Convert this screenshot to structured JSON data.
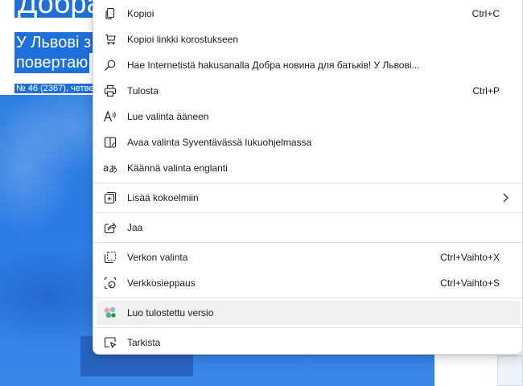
{
  "article": {
    "title_top": "Добра",
    "headline_line1": "У Львові з",
    "headline_line2": "повертаю",
    "meta": "№ 46 (2367), четве"
  },
  "menu": {
    "items": [
      {
        "label": "Kopioi",
        "shortcut": "Ctrl+C",
        "icon": "copy-icon"
      },
      {
        "label": "Kopioi linkki korostukseen",
        "shortcut": "",
        "icon": "link-highlight-icon"
      },
      {
        "label": "Hae Internetistä hakusanalla Добра новина для батьків! У Львові...",
        "shortcut": "",
        "icon": "search-icon"
      },
      {
        "label": "Tulosta",
        "shortcut": "Ctrl+P",
        "icon": "print-icon"
      },
      {
        "label": "Lue valinta ääneen",
        "shortcut": "",
        "icon": "read-aloud-icon"
      },
      {
        "label": "Avaa valinta Syventävässä lukuohjelmassa",
        "shortcut": "",
        "icon": "immersive-reader-icon"
      },
      {
        "label": "Käännä valinta englanti",
        "shortcut": "",
        "icon": "translate-icon"
      },
      {
        "label": "Lisää kokoelmiin",
        "shortcut": "",
        "icon": "collections-icon"
      },
      {
        "label": "Jaa",
        "shortcut": "",
        "icon": "share-icon"
      },
      {
        "label": "Verkon valinta",
        "shortcut": "Ctrl+Vaihto+X",
        "icon": "web-select-icon"
      },
      {
        "label": "Verkkosieppaus",
        "shortcut": "Ctrl+Vaihto+S",
        "icon": "web-capture-icon"
      },
      {
        "label": "Luo tulostettu versio",
        "shortcut": "",
        "icon": "print-version-icon"
      },
      {
        "label": "Tarkista",
        "shortcut": "",
        "icon": "inspect-icon"
      }
    ]
  },
  "colors": {
    "hero_blue": "#2c7be5",
    "menu_bg": "#ffffff",
    "highlight": "#f0f0f0"
  }
}
